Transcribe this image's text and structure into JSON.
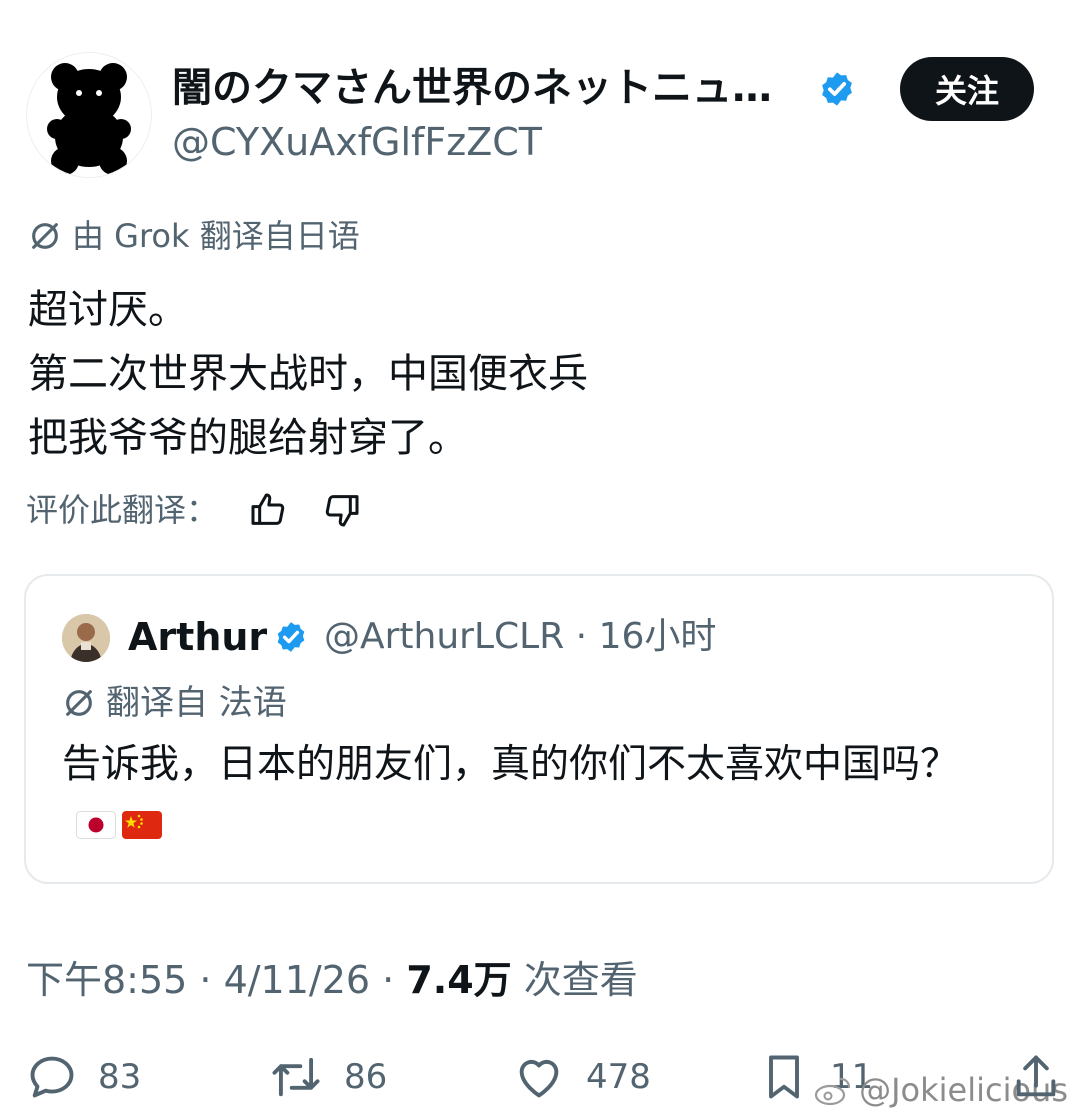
{
  "header": {
    "display_name": "闇のクマさん世界のネットニュ…",
    "handle": "@CYXuAxfGlfFzZCT",
    "follow_label": "关注"
  },
  "translation": {
    "label": "由 Grok 翻译自日语"
  },
  "body": {
    "text": "超讨厌。\n第二次世界大战时，中国便衣兵\n把我爷爷的腿给射穿了。"
  },
  "rating": {
    "label": "评价此翻译："
  },
  "quote": {
    "name": "Arthur",
    "handle_time": "@ArthurLCLR · 16小时",
    "translate_label": "翻译自 法语",
    "text": "告诉我，日本的朋友们，真的你们不太喜欢中国吗？"
  },
  "meta": {
    "time_date": "下午8:55 · 4/11/26 · ",
    "views": "7.4万",
    "views_suffix": " 次查看"
  },
  "actions": {
    "replies": "83",
    "reposts": "86",
    "likes": "478",
    "bookmarks": "11"
  },
  "watermark": {
    "text": "@Jokielicious"
  },
  "colors": {
    "verified_blue": "#1d9bf0",
    "text_primary": "#0f1419",
    "text_secondary": "#536471"
  }
}
